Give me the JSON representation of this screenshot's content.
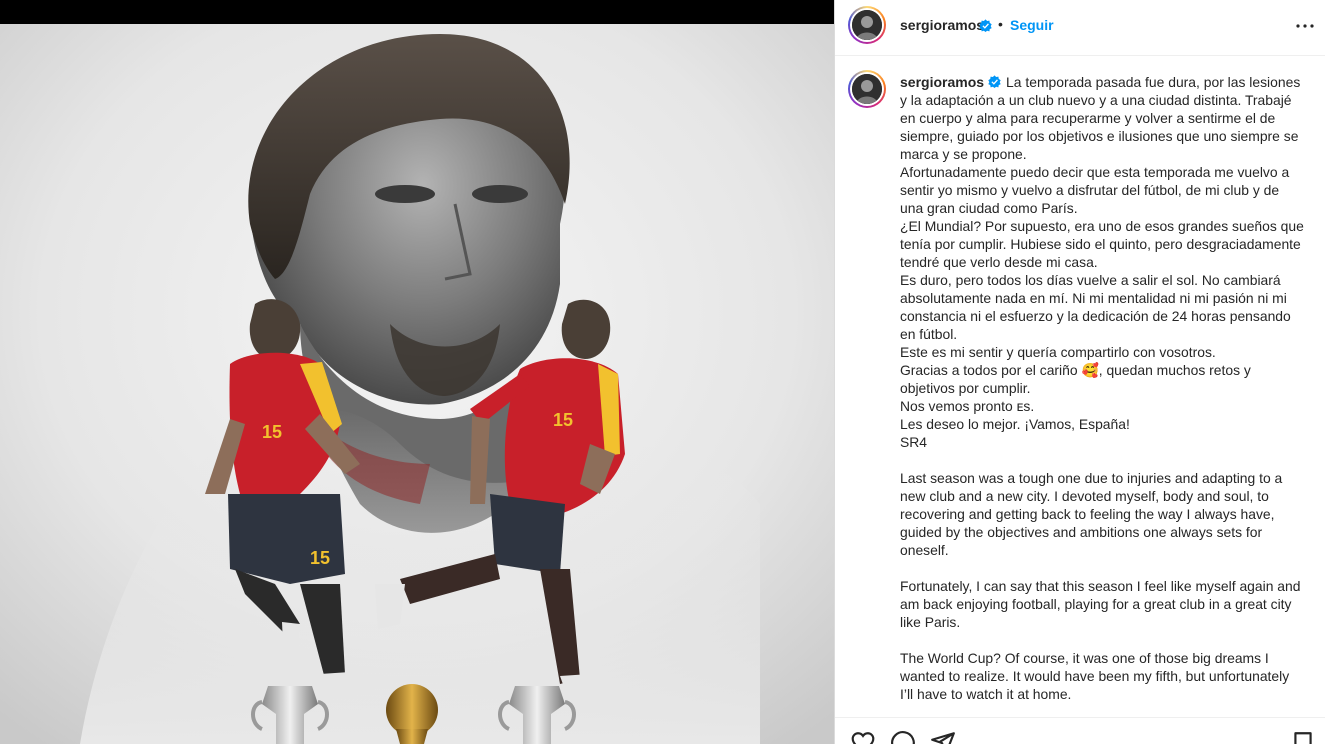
{
  "post": {
    "username": "sergioramos",
    "verified": true,
    "separator": "•",
    "follow_label": "Seguir",
    "more_icon": "more-horizontal-icon",
    "caption_paragraphs": [
      "La temporada pasada fue dura, por las lesiones y la adaptación a un club nuevo y a una ciudad distinta. Trabajé en cuerpo y alma para recuperarme y volver a sentirme el de siempre, guiado por los objetivos e ilusiones que uno siempre se marca y se propone.",
      "Afortunadamente puedo decir que esta temporada me vuelvo a sentir yo mismo y vuelvo a disfrutar del fútbol, de mi club y de una gran ciudad como París.",
      "¿El Mundial? Por supuesto, era uno de esos grandes sueños que tenía por cumplir. Hubiese sido el quinto, pero desgraciadamente tendré que verlo desde mi casa.",
      "Es duro, pero todos los días vuelve a salir el sol. No cambiará absolutamente nada en mí. Ni mi mentalidad ni mi pasión ni mi constancia ni el esfuerzo y la dedicación de 24 horas pensando en fútbol.",
      "Este es mi sentir y quería compartirlo con vosotros.",
      "Gracias a todos por el cariño 🥰, quedan muchos retos y objetivos por cumplir.",
      "Nos vemos pronto ᴇs.",
      "Les deseo lo mejor. ¡Vamos, España!",
      "SR4"
    ],
    "caption_en": [
      "Last season was a tough one due to injuries and adapting to a new club and a new city. I devoted myself, body and soul, to recovering and getting back to feeling the way I always have, guided by the objectives and ambitions one always sets for oneself.",
      "Fortunately, I can say that this season I feel like myself again and am back enjoying football, playing for a great club in a great city like Paris.",
      "The World Cup? Of course, it was one of those big dreams I wanted to realize. It would have been my fifth, but unfortunately I’ll have to watch it at home."
    ],
    "jersey_number": "15"
  },
  "actions": {
    "like_icon": "heart-icon",
    "comment_icon": "comment-icon",
    "share_icon": "share-icon",
    "save_icon": "bookmark-icon"
  },
  "colors": {
    "accent": "#0095f6",
    "text": "#262626",
    "border": "#dbdbdb",
    "jersey_red": "#c8202a",
    "jersey_yellow": "#f2c12e"
  }
}
